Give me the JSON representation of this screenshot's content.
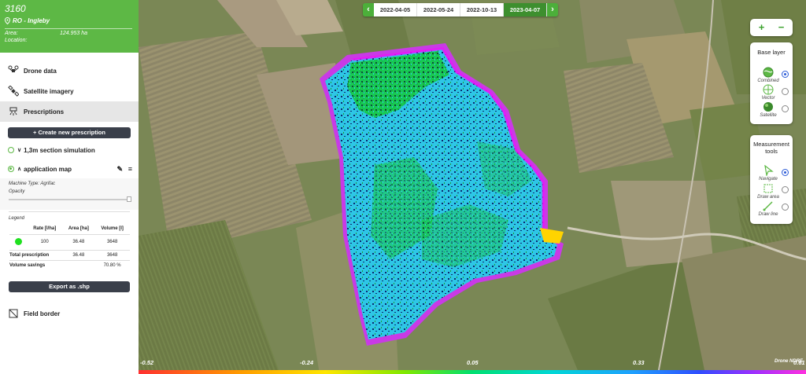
{
  "field": {
    "id": "3160",
    "owner": "RO - Ingleby",
    "area_label": "Area:",
    "area_value": "124.953 ha",
    "location_label": "Location:",
    "location_value": ""
  },
  "nav": {
    "drone_data": "Drone data",
    "satellite_imagery": "Satellite imagery",
    "prescriptions": "Prescriptions",
    "field_border": "Field border"
  },
  "prescriptions": {
    "create_button": "+ Create new prescription",
    "items": [
      {
        "name": "1,3m section simulation",
        "expanded": false
      },
      {
        "name": "application map",
        "expanded": true
      }
    ],
    "machine_type": "Machine Type: Agrifac",
    "opacity_label": "Opacity",
    "opacity_value": 1.0,
    "legend_label": "Legend",
    "legend": {
      "headers": [
        "Rate [l/ha]",
        "Area [ha]",
        "Volume [l]"
      ],
      "rows": [
        {
          "color": "#1fe01f",
          "rate": "100",
          "area": "36.48",
          "volume": "3648"
        }
      ],
      "total_label": "Total prescription",
      "total_area": "36.48",
      "total_volume": "3648",
      "savings_label": "Volume savings",
      "savings_value": "70.80 %"
    },
    "export_button": "Export as .shp"
  },
  "dates": {
    "tabs": [
      "2022-04-05",
      "2022-05-24",
      "2022-10-13",
      "2023-04-07"
    ],
    "active_index": 3
  },
  "zoom": {
    "in": "+",
    "out": "−"
  },
  "base_layer": {
    "title": "Base layer",
    "options": [
      {
        "label": "Combined",
        "icon": "globe-combined-icon",
        "selected": true
      },
      {
        "label": "Vector",
        "icon": "globe-vector-icon",
        "selected": false
      },
      {
        "label": "Satellite",
        "icon": "globe-satellite-icon",
        "selected": false
      }
    ]
  },
  "measurement": {
    "title": "Measurement tools",
    "options": [
      {
        "label": "Navigate",
        "icon": "cursor-icon",
        "selected": true
      },
      {
        "label": "Draw area",
        "icon": "draw-area-icon",
        "selected": false
      },
      {
        "label": "Draw line",
        "icon": "draw-line-icon",
        "selected": false
      }
    ]
  },
  "ndvi_scale": {
    "ticks": [
      "-0.52",
      "-0.24",
      "0.05",
      "0.33",
      "0.61"
    ],
    "label": "Drone NDRE"
  },
  "colors": {
    "brand_green": "#5db845",
    "dark_button": "#3a3f4a",
    "active_date": "#3d8f2e"
  }
}
